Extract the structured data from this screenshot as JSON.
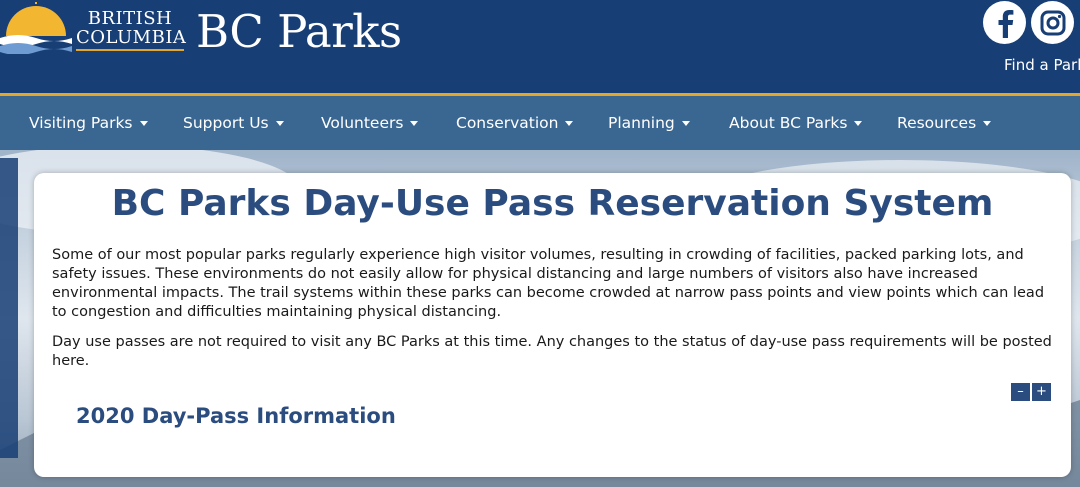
{
  "header": {
    "gov_line1": "BRITISH",
    "gov_line2": "COLUMBIA",
    "brand": "BC Parks",
    "find_park": "Find a Park",
    "icons": {
      "facebook": "facebook-icon",
      "instagram": "instagram-icon"
    },
    "colors": {
      "header_bg": "#173e75",
      "nav_bg": "#3a6791",
      "accent": "#e3a82b"
    }
  },
  "nav": {
    "items": [
      {
        "label": "Visiting Parks"
      },
      {
        "label": "Support Us"
      },
      {
        "label": "Volunteers"
      },
      {
        "label": "Conservation"
      },
      {
        "label": "Planning"
      },
      {
        "label": "About BC Parks"
      },
      {
        "label": "Resources"
      }
    ]
  },
  "main": {
    "title": "BC Parks Day-Use Pass Reservation System",
    "paragraph1": "Some of our most popular parks regularly experience high visitor volumes, resulting in crowding of facilities, packed parking lots, and safety issues. These environments do not easily allow for physical distancing and large numbers of visitors also have increased environmental impacts. The trail systems within these parks can become crowded at narrow pass points and view points which can lead to congestion and difficulties maintaining physical distancing.",
    "paragraph2": "Day use passes are not required to visit any BC Parks at this time. Any changes to the status of day-use pass requirements will be posted here.",
    "collapse_label": "–",
    "expand_label": "+",
    "section_heading": "2020 Day-Pass Information"
  }
}
